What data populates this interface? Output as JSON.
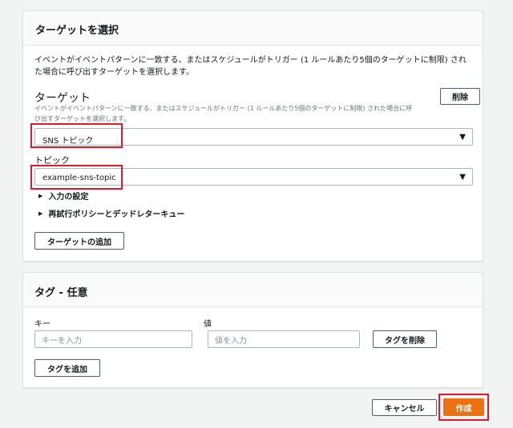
{
  "target_section": {
    "title": "ターゲットを選択",
    "description_line1": "イベントがイベントパターンに一致する、またはスケジュールがトリガー (1 ルールあたり5個のターゲットに制限) され",
    "description_line2": "た場合に呼び出すターゲットを選択します。",
    "target_label": "ターゲット",
    "target_desc_line1": "イベントがイベントパターンに一致する、またはスケジュールがトリガー (1 ルールあたり5個のターゲットに制限) された場合に呼",
    "target_desc_line2": "び出すターゲットを選択します。",
    "delete_label": "削除",
    "target_select_value": "SNS トピック",
    "topic_label": "トピック",
    "topic_select_value": "example-sns-topic",
    "input_settings_label": "入力の設定",
    "retry_policy_label": "再試行ポリシーとデッドレターキュー",
    "add_target_label": "ターゲットの追加",
    "dropdown_arrow": "▼",
    "expand_arrow": "▶"
  },
  "tag_section": {
    "title": "タグ - 任意",
    "key_label": "キー",
    "value_label": "値",
    "key_placeholder": "キーを入力",
    "value_placeholder": "値を入力",
    "delete_tag_label": "タグを削除",
    "add_tag_label": "タグを追加"
  },
  "footer": {
    "cancel_label": "キャンセル",
    "create_label": "作成"
  },
  "colors": {
    "accent": "#ec7211",
    "highlight": "#e0192e"
  }
}
